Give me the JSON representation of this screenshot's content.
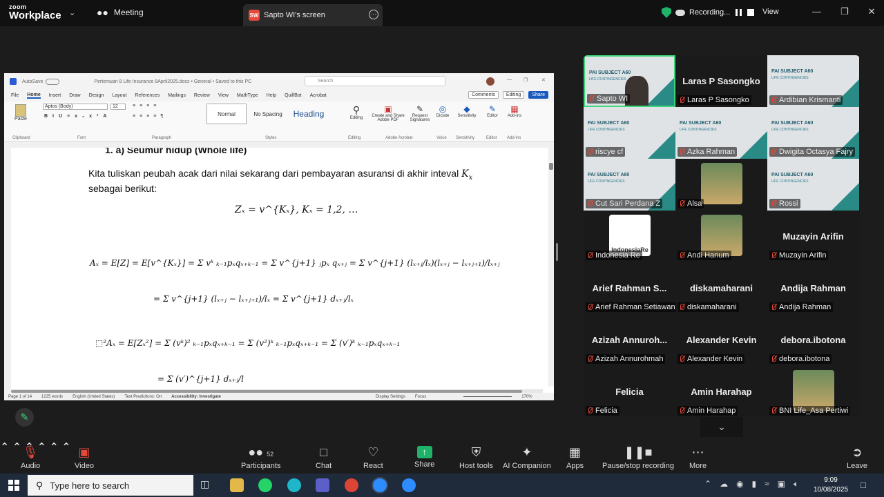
{
  "topbar": {
    "logo_line1": "zoom",
    "logo_line2": "Workplace",
    "meeting_label": "Meeting",
    "share_initials": "SW",
    "share_title": "Sapto WI's screen",
    "recording_label": "Recording...",
    "view_label": "View"
  },
  "word": {
    "autosave": "AutoSave",
    "filename": "Pertemuan 8 Life Insurance 8April2025.docx • General • Saved to this PC",
    "search_placeholder": "Search",
    "menu": [
      "File",
      "Home",
      "Insert",
      "Draw",
      "Design",
      "Layout",
      "References",
      "Mailings",
      "Review",
      "View",
      "MathType",
      "Help",
      "QuillBot",
      "Acrobat"
    ],
    "menu_active": "Home",
    "comments": "Comments",
    "editing": "Editing",
    "share": "Share",
    "font_name": "Aptos (Body)",
    "font_size": "12",
    "styles": [
      "Normal",
      "No Spacing",
      "Heading"
    ],
    "groups": [
      "Clipboard",
      "Font",
      "Paragraph",
      "Styles",
      "Editing",
      "Adobe Acrobat",
      "Voice",
      "Sensitivity",
      "Editor",
      "Add-ins"
    ],
    "ribbon_buttons": [
      "Paste",
      "Editing",
      "Create and Share Adobe PDF",
      "Request Signatures",
      "Dictate",
      "Sensitivity",
      "Editor",
      "Add-ins"
    ],
    "heading": "1.  a) Seumur hidup (Whole life)",
    "para1": "Kita tuliskan peubah acak dari nilai sekarang dari pembayaran asuransi di akhir inteval",
    "para1_var": "K",
    "para1_sub": "x",
    "para2": "sebagai berikut:",
    "eq_z": "Zₓ = v^{Kₓ},      Kₓ = 1,2, …",
    "eq_a1": "Aₓ = E[Z] = E[v^{Kₓ}] = Σ vᵏ ₖ₋₁pₓqₓ₊ₖ₋₁ = Σ v^{j+1} ⱼpₓ qₓ₊ⱼ = Σ v^{j+1} (lₓ₊ⱼ/lₓ)(lₓ₊ⱼ − lₓ₊ⱼ₊₁)/lₓ₊ⱼ",
    "eq_a2": "= Σ v^{j+1} (lₓ₊ⱼ − lₓ₊ⱼ₊₁)/lₓ = Σ v^{j+1} dₓ₊ⱼ/lₓ",
    "eq_a3": "⬚²Aₓ = E[Zₓ²] = Σ (vᵏ)² ₖ₋₁pₓqₓ₊ₖ₋₁ = Σ (v²)ᵏ ₖ₋₁pₓqₓ₊ₖ₋₁ = Σ (v′)ᵏ ₖ₋₁pₓqₓ₊ₖ₋₁",
    "eq_a4": "= Σ (v′)^{j+1} dₓ₊ⱼ/l",
    "status_page": "Page 1 of 14",
    "status_words": "1225 words",
    "status_lang": "English (United States)",
    "status_pred": "Text Predictions: On",
    "status_access": "Accessibility: Investigate",
    "status_display": "Display Settings",
    "status_focus": "Focus",
    "status_zoom": "170%"
  },
  "gallery": {
    "slide_banner": "PAI SUBJECT A60",
    "slide_sub": "LIFE CONTINGENCIES",
    "tiles": [
      {
        "name": "Sapto WI",
        "big": "",
        "type": "video"
      },
      {
        "name": "Laras P Sasongko",
        "big": "Laras P Sasongko",
        "type": "name"
      },
      {
        "name": "Ardibian Krismanti",
        "big": "",
        "type": "slide"
      },
      {
        "name": "riscye cf",
        "big": "",
        "type": "slide"
      },
      {
        "name": "Azka Rahman",
        "big": "",
        "type": "slide"
      },
      {
        "name": "Dwigita Octasya Fajry",
        "big": "",
        "type": "slide"
      },
      {
        "name": "Cut Sari Perdana Z",
        "big": "",
        "type": "slide"
      },
      {
        "name": "Alsa",
        "big": "",
        "type": "avatar"
      },
      {
        "name": "Rossi",
        "big": "",
        "type": "slide"
      },
      {
        "name": "Indonesia Re",
        "big": "",
        "type": "logo"
      },
      {
        "name": "Andi Hanum",
        "big": "",
        "type": "avatar"
      },
      {
        "name": "Muzayin Arifin",
        "big": "Muzayin Arifin",
        "type": "name"
      },
      {
        "name": "Arief Rahman Setiawan",
        "big": "Arief Rahman S...",
        "type": "name"
      },
      {
        "name": "diskamaharani",
        "big": "diskamaharani",
        "type": "name"
      },
      {
        "name": "Andija Rahman",
        "big": "Andija Rahman",
        "type": "name"
      },
      {
        "name": "Azizah Annurohmah",
        "big": "Azizah Annuroh...",
        "type": "name"
      },
      {
        "name": "Alexander Kevin",
        "big": "Alexander Kevin",
        "type": "name"
      },
      {
        "name": "debora.ibotona",
        "big": "debora.ibotona",
        "type": "name"
      },
      {
        "name": "Felicia",
        "big": "Felicia",
        "type": "name"
      },
      {
        "name": "Amin Harahap",
        "big": "Amin Harahap",
        "type": "name"
      },
      {
        "name": "BNI Life_Asa Pertiwi",
        "big": "",
        "type": "avatar"
      }
    ],
    "logo_text": "IndonesiaRe"
  },
  "toolbar": {
    "audio": "Audio",
    "video": "Video",
    "participants": "Participants",
    "participants_count": "52",
    "chat": "Chat",
    "react": "React",
    "share": "Share",
    "host_tools": "Host tools",
    "ai_companion": "AI Companion",
    "apps": "Apps",
    "pause_recording": "Pause/stop recording",
    "more": "More",
    "leave": "Leave"
  },
  "taskbar": {
    "search_placeholder": "Type here to search",
    "time": "9:09",
    "date": "10/08/2025"
  },
  "colors": {
    "zoom_green": "#3cd67b",
    "mute_red": "#e3493a",
    "word_blue": "#185abd",
    "slide_teal": "#2a8a86"
  }
}
